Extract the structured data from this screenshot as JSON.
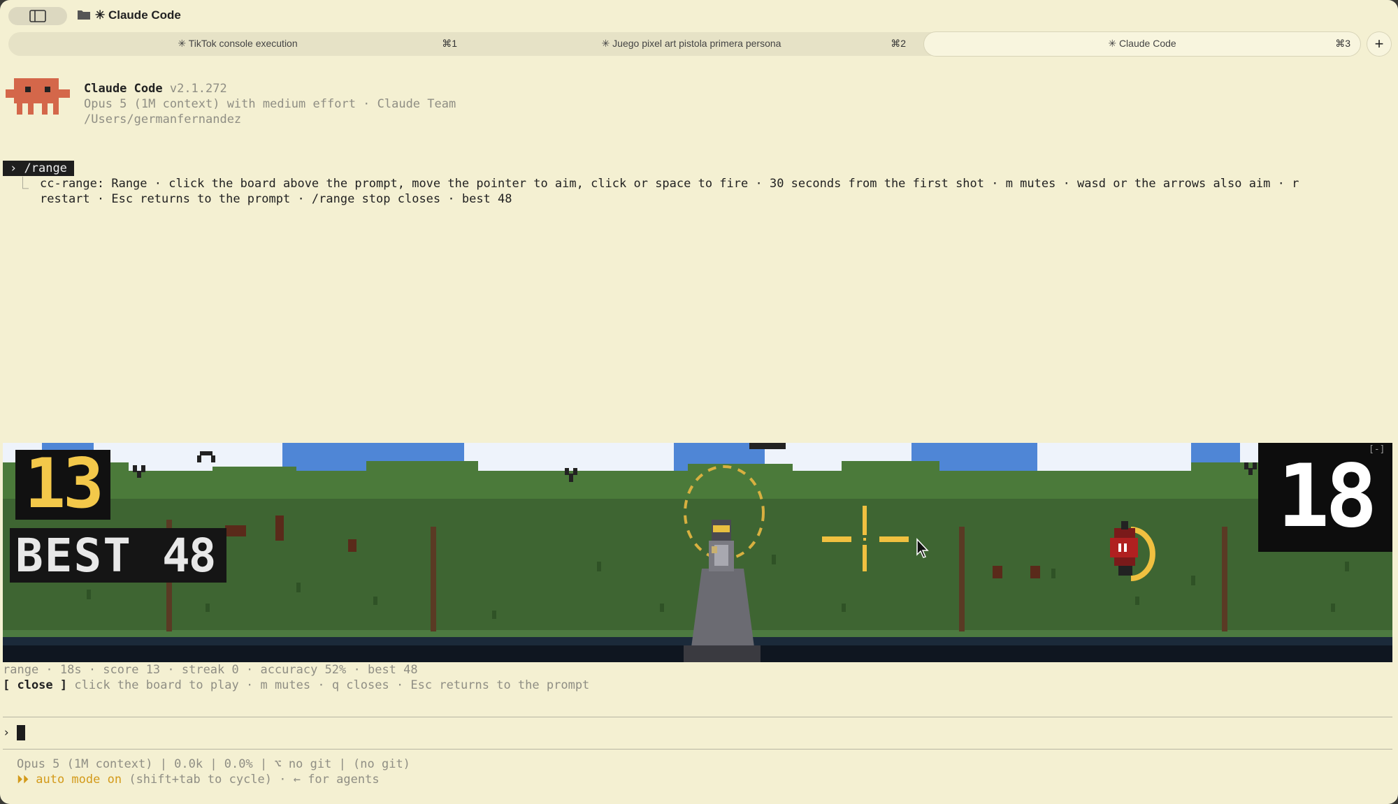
{
  "window": {
    "title": "✳ Claude Code"
  },
  "tabs": [
    {
      "label": "✳ TikTok console execution",
      "shortcut": "⌘1"
    },
    {
      "label": "✳ Juego pixel art pistola primera persona",
      "shortcut": "⌘2"
    },
    {
      "label": "✳ Claude Code",
      "shortcut": "⌘3",
      "active": true
    }
  ],
  "new_tab_label": "+",
  "header": {
    "app_name": "Claude Code",
    "version": "v2.1.272",
    "model_line": "Opus 5 (1M context) with medium effort · Claude Team",
    "cwd": "/Users/germanfernandez"
  },
  "command": {
    "prompt_marker": "›",
    "text": "/range",
    "tree_marker": "⎿",
    "output_line1": "cc-range: Range · click the board above the prompt, move the pointer to aim, click or space to fire · 30 seconds from the first shot · m mutes · wasd or the arrows also aim · r",
    "output_line2": "restart · Esc returns to the prompt · /range stop closes · best 48"
  },
  "game": {
    "score": "13",
    "best_label": "BEST",
    "best_value": "48",
    "timer": "18",
    "minimize_label": "[-]",
    "colors": {
      "score": "#f3c84a",
      "sky": "#4f86d6",
      "grass": "#3e6532",
      "crosshair": "#f0c040"
    }
  },
  "status": {
    "line": "range · 18s · score 13 · streak 0 · accuracy 52% · best 48",
    "close_label": "[ close ]",
    "hint": "click the board to play · m mutes · q closes · Esc returns to the prompt"
  },
  "prompt": {
    "marker": "›"
  },
  "footer": {
    "model_info": "Opus 5 (1M context) | 0.0k | 0.0% | ⌥ no git | (no git)",
    "mode_icon": "⏵⏵",
    "mode_label": "auto mode on",
    "mode_hint": "(shift+tab to cycle) · ← for agents"
  }
}
